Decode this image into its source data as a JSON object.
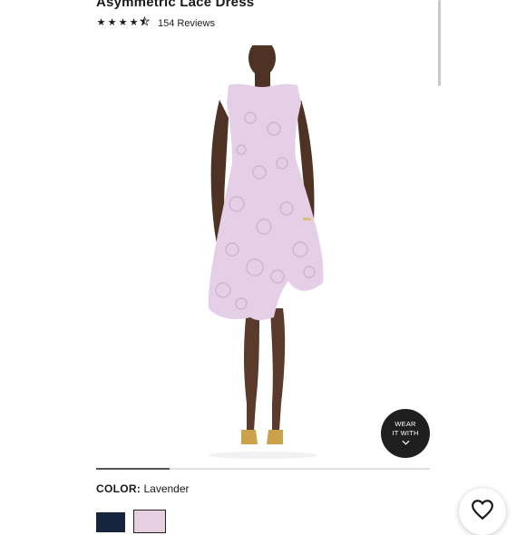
{
  "product": {
    "title": "Asymmetric Lace Dress",
    "rating": 4.5,
    "reviews_text": "154 Reviews"
  },
  "gallery": {
    "image_alt": "Lavender asymmetric lace dress worn by model",
    "wear_it_with_line1": "WEAR",
    "wear_it_with_line2": "IT WITH",
    "progress": 0.22
  },
  "color": {
    "label": "COLOR:",
    "value": "Lavender",
    "swatches": [
      {
        "name": "Navy",
        "hex": "#17243d",
        "selected": false
      },
      {
        "name": "Lavender",
        "hex": "#e6cfe1",
        "selected": true
      }
    ]
  },
  "icons": {
    "star": "star-icon",
    "favorite": "heart-outline-icon",
    "wear_chevron": "chevron-down-icon"
  },
  "colors": {
    "dress": "#e4cfe6",
    "skin": "#5a3a2a",
    "text": "#1a1a1a"
  }
}
